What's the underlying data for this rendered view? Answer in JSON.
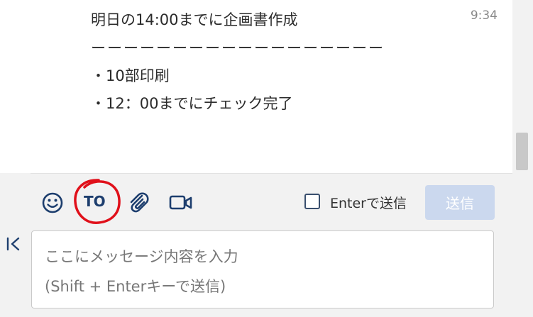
{
  "message": {
    "lines": [
      "明日の14:00までに企画書作成",
      "ーーーーーーーーーーーーーーーーーー",
      "・10部印刷",
      "・12：00までにチェック完了"
    ],
    "time": "9:34"
  },
  "toolbar": {
    "emoji_icon": "smiley-icon",
    "to_label": "TO",
    "attach_icon": "paperclip-icon",
    "video_icon": "video-camera-icon",
    "enter_send_label": "Enterで送信",
    "enter_send_checked": false,
    "send_label": "送信"
  },
  "composer": {
    "placeholder_line1": "ここにメッセージ内容を入力",
    "placeholder_line2": "(Shift + Enterキーで送信)"
  },
  "colors": {
    "accent": "#1d3e6e",
    "send_disabled": "#cbd8ee",
    "annotation_circle": "#e0101a"
  }
}
